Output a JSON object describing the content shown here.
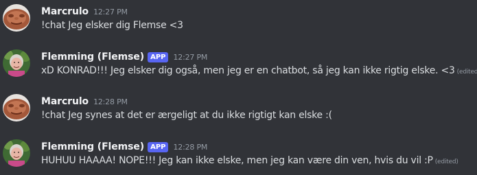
{
  "messages": [
    {
      "author": "Marcrulo",
      "app_tag": "",
      "time": "12:27 PM",
      "text": "!chat Jeg elsker dig Flemse <3",
      "edited": "",
      "avatar_icon": "marcrulo-avatar-icon"
    },
    {
      "author": "Flemming (Flemse)",
      "app_tag": "APP",
      "time": "12:27 PM",
      "text": "xD KONRAD!!! Jeg elsker dig også, men jeg er en chatbot, så jeg kan ikke rigtig elske. <3",
      "edited": "(edited)",
      "avatar_icon": "flemming-avatar-icon"
    },
    {
      "author": "Marcrulo",
      "app_tag": "",
      "time": "12:28 PM",
      "text": "!chat Jeg synes at det er ærgeligt at du ikke rigtigt kan elske :(",
      "edited": "",
      "avatar_icon": "marcrulo-avatar-icon"
    },
    {
      "author": "Flemming (Flemse)",
      "app_tag": "APP",
      "time": "12:28 PM",
      "text": "HUHUU HAAAA! NOPE!!! Jeg kan ikke elske, men jeg kan være din ven, hvis du vil :P",
      "edited": "(edited)",
      "avatar_icon": "flemming-avatar-icon"
    }
  ],
  "colors": {
    "background": "#313338",
    "username": "#f2f3f5",
    "message_text": "#dbdee1",
    "timestamp": "#949ba4",
    "app_tag": "#5865f2"
  }
}
